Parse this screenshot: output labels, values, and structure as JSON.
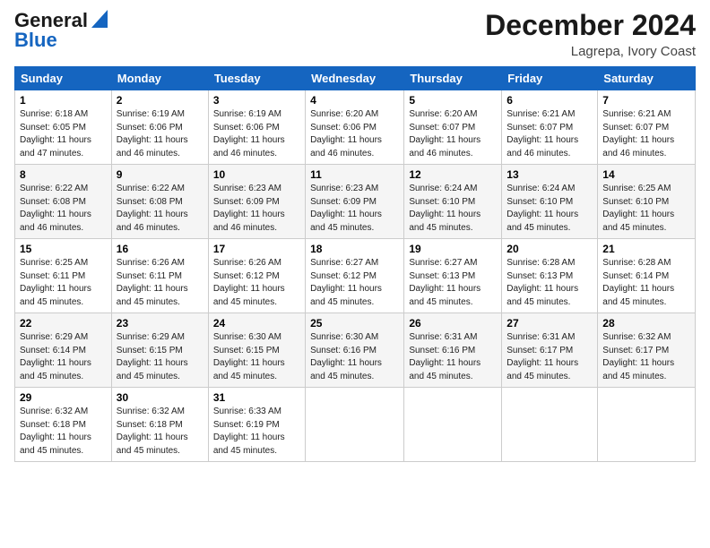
{
  "header": {
    "logo_line1": "General",
    "logo_line2": "Blue",
    "month_year": "December 2024",
    "location": "Lagrepa, Ivory Coast"
  },
  "columns": [
    "Sunday",
    "Monday",
    "Tuesday",
    "Wednesday",
    "Thursday",
    "Friday",
    "Saturday"
  ],
  "weeks": [
    [
      {
        "day": "1",
        "info": "Sunrise: 6:18 AM\nSunset: 6:05 PM\nDaylight: 11 hours\nand 47 minutes."
      },
      {
        "day": "2",
        "info": "Sunrise: 6:19 AM\nSunset: 6:06 PM\nDaylight: 11 hours\nand 46 minutes."
      },
      {
        "day": "3",
        "info": "Sunrise: 6:19 AM\nSunset: 6:06 PM\nDaylight: 11 hours\nand 46 minutes."
      },
      {
        "day": "4",
        "info": "Sunrise: 6:20 AM\nSunset: 6:06 PM\nDaylight: 11 hours\nand 46 minutes."
      },
      {
        "day": "5",
        "info": "Sunrise: 6:20 AM\nSunset: 6:07 PM\nDaylight: 11 hours\nand 46 minutes."
      },
      {
        "day": "6",
        "info": "Sunrise: 6:21 AM\nSunset: 6:07 PM\nDaylight: 11 hours\nand 46 minutes."
      },
      {
        "day": "7",
        "info": "Sunrise: 6:21 AM\nSunset: 6:07 PM\nDaylight: 11 hours\nand 46 minutes."
      }
    ],
    [
      {
        "day": "8",
        "info": "Sunrise: 6:22 AM\nSunset: 6:08 PM\nDaylight: 11 hours\nand 46 minutes."
      },
      {
        "day": "9",
        "info": "Sunrise: 6:22 AM\nSunset: 6:08 PM\nDaylight: 11 hours\nand 46 minutes."
      },
      {
        "day": "10",
        "info": "Sunrise: 6:23 AM\nSunset: 6:09 PM\nDaylight: 11 hours\nand 46 minutes."
      },
      {
        "day": "11",
        "info": "Sunrise: 6:23 AM\nSunset: 6:09 PM\nDaylight: 11 hours\nand 45 minutes."
      },
      {
        "day": "12",
        "info": "Sunrise: 6:24 AM\nSunset: 6:10 PM\nDaylight: 11 hours\nand 45 minutes."
      },
      {
        "day": "13",
        "info": "Sunrise: 6:24 AM\nSunset: 6:10 PM\nDaylight: 11 hours\nand 45 minutes."
      },
      {
        "day": "14",
        "info": "Sunrise: 6:25 AM\nSunset: 6:10 PM\nDaylight: 11 hours\nand 45 minutes."
      }
    ],
    [
      {
        "day": "15",
        "info": "Sunrise: 6:25 AM\nSunset: 6:11 PM\nDaylight: 11 hours\nand 45 minutes."
      },
      {
        "day": "16",
        "info": "Sunrise: 6:26 AM\nSunset: 6:11 PM\nDaylight: 11 hours\nand 45 minutes."
      },
      {
        "day": "17",
        "info": "Sunrise: 6:26 AM\nSunset: 6:12 PM\nDaylight: 11 hours\nand 45 minutes."
      },
      {
        "day": "18",
        "info": "Sunrise: 6:27 AM\nSunset: 6:12 PM\nDaylight: 11 hours\nand 45 minutes."
      },
      {
        "day": "19",
        "info": "Sunrise: 6:27 AM\nSunset: 6:13 PM\nDaylight: 11 hours\nand 45 minutes."
      },
      {
        "day": "20",
        "info": "Sunrise: 6:28 AM\nSunset: 6:13 PM\nDaylight: 11 hours\nand 45 minutes."
      },
      {
        "day": "21",
        "info": "Sunrise: 6:28 AM\nSunset: 6:14 PM\nDaylight: 11 hours\nand 45 minutes."
      }
    ],
    [
      {
        "day": "22",
        "info": "Sunrise: 6:29 AM\nSunset: 6:14 PM\nDaylight: 11 hours\nand 45 minutes."
      },
      {
        "day": "23",
        "info": "Sunrise: 6:29 AM\nSunset: 6:15 PM\nDaylight: 11 hours\nand 45 minutes."
      },
      {
        "day": "24",
        "info": "Sunrise: 6:30 AM\nSunset: 6:15 PM\nDaylight: 11 hours\nand 45 minutes."
      },
      {
        "day": "25",
        "info": "Sunrise: 6:30 AM\nSunset: 6:16 PM\nDaylight: 11 hours\nand 45 minutes."
      },
      {
        "day": "26",
        "info": "Sunrise: 6:31 AM\nSunset: 6:16 PM\nDaylight: 11 hours\nand 45 minutes."
      },
      {
        "day": "27",
        "info": "Sunrise: 6:31 AM\nSunset: 6:17 PM\nDaylight: 11 hours\nand 45 minutes."
      },
      {
        "day": "28",
        "info": "Sunrise: 6:32 AM\nSunset: 6:17 PM\nDaylight: 11 hours\nand 45 minutes."
      }
    ],
    [
      {
        "day": "29",
        "info": "Sunrise: 6:32 AM\nSunset: 6:18 PM\nDaylight: 11 hours\nand 45 minutes."
      },
      {
        "day": "30",
        "info": "Sunrise: 6:32 AM\nSunset: 6:18 PM\nDaylight: 11 hours\nand 45 minutes."
      },
      {
        "day": "31",
        "info": "Sunrise: 6:33 AM\nSunset: 6:19 PM\nDaylight: 11 hours\nand 45 minutes."
      },
      {
        "day": "",
        "info": ""
      },
      {
        "day": "",
        "info": ""
      },
      {
        "day": "",
        "info": ""
      },
      {
        "day": "",
        "info": ""
      }
    ]
  ]
}
